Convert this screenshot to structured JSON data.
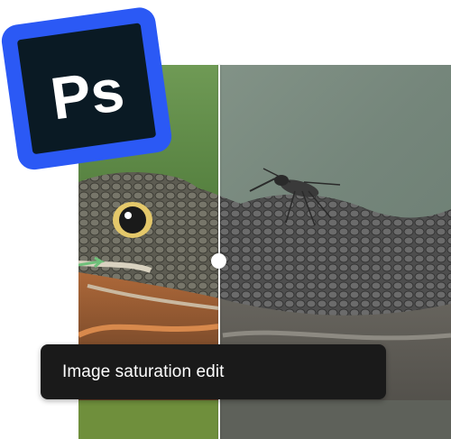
{
  "logo": {
    "text": "Ps",
    "icon": "photoshop-logo-icon",
    "colors": {
      "frame": "#2b59f5",
      "inner": "#0a1a24",
      "text": "#ffffff"
    }
  },
  "comparison": {
    "before_label": "original",
    "after_label": "desaturated",
    "subject": "snake-with-mosquito-photo",
    "colors": {
      "before_background": "#5f8a45",
      "after_background": "#7f8f85",
      "divider": "#f4f4f4"
    }
  },
  "caption": {
    "text": "Image saturation edit",
    "colors": {
      "background": "#1a1a1a",
      "text": "#ffffff"
    }
  }
}
